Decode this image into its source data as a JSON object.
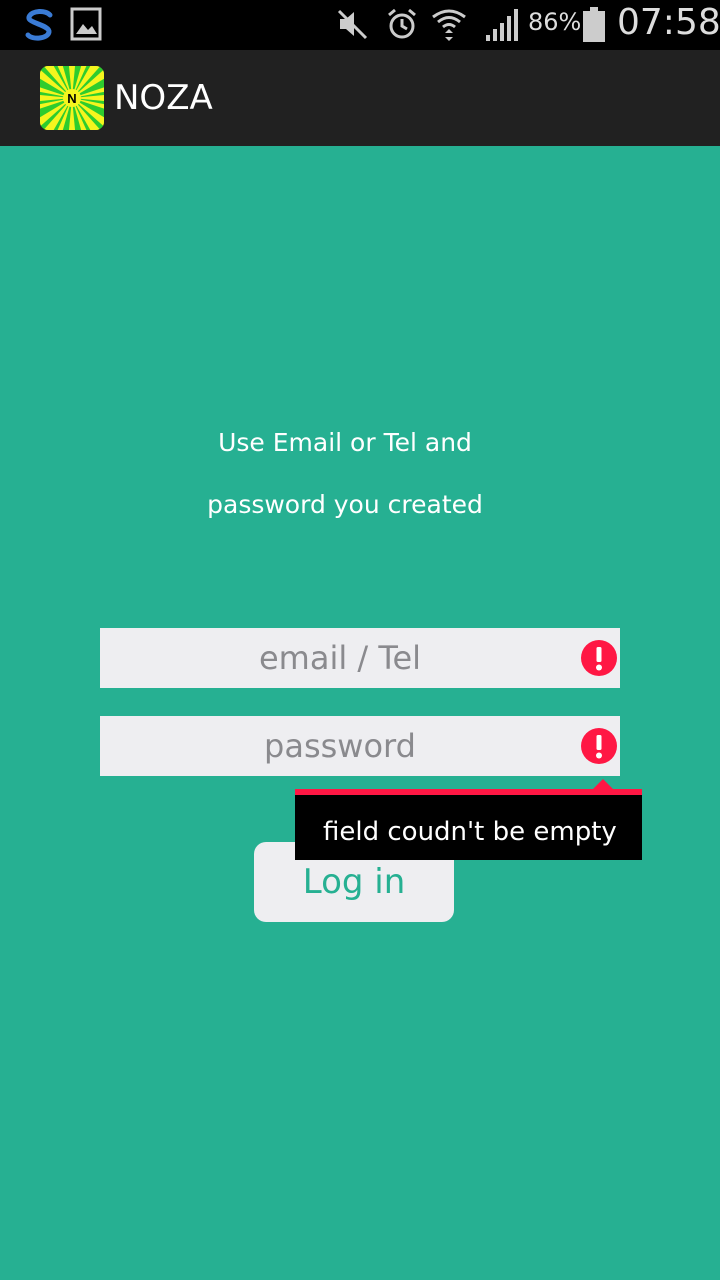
{
  "status_bar": {
    "battery_percent": "86%",
    "time": "07:58",
    "icons": [
      "sync-icon",
      "gallery-icon",
      "mute-icon",
      "alarm-icon",
      "wifi-icon",
      "signal-icon",
      "battery-icon"
    ]
  },
  "app": {
    "title": "NOZA",
    "logo_icon": "noza-logo-icon"
  },
  "login": {
    "instruction_line1": "Use Email or Tel  and",
    "instruction_line2": "password you created",
    "email_placeholder": "email / Tel",
    "password_placeholder": "password",
    "login_button_label": "Log in",
    "error_message": "field coudn't be empty"
  },
  "colors": {
    "background": "#26b092",
    "action_bar": "#212121",
    "field_background": "#eeeef1",
    "error_red": "#ff1744"
  }
}
